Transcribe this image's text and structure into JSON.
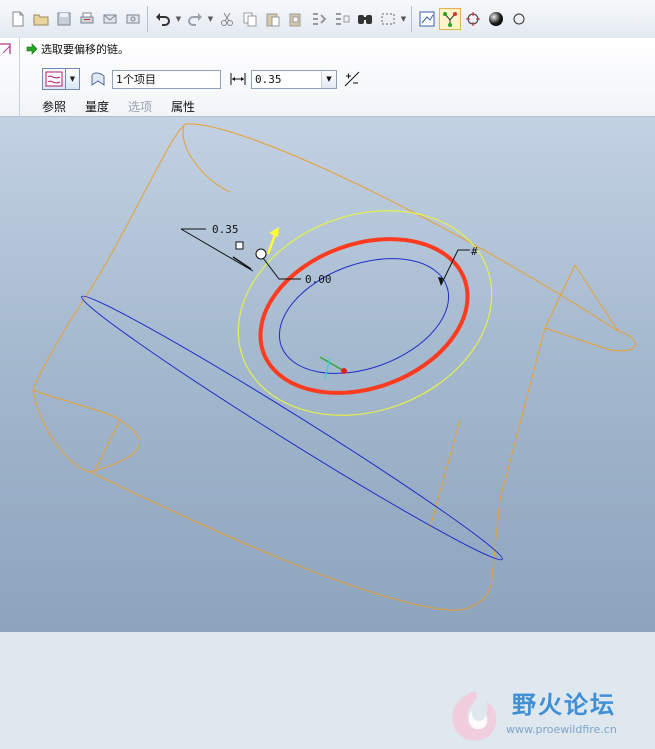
{
  "toolbar": {
    "icons": [
      "new-icon",
      "open-icon",
      "save-icon",
      "print-icon",
      "email-icon",
      "email-link-icon",
      "undo-icon",
      "redo-icon",
      "cut-icon",
      "copy-icon",
      "paste-icon",
      "paste-special-icon",
      "regenerate-icon",
      "regen-manager-icon",
      "find-icon",
      "select-box-icon",
      "sketch-view-icon",
      "datum-display-icon",
      "spin-center-icon",
      "shading-icon"
    ]
  },
  "dashboard": {
    "prompt": "选取要偏移的链。",
    "items_value": "1个项目",
    "offset_value": "0.35",
    "tabs": [
      "参照",
      "量度",
      "选项",
      "属性"
    ],
    "disabled_tab": "选项"
  },
  "canvas": {
    "dim_offset": "0.35",
    "dim_zero": "0.00",
    "dim_hash": "#",
    "colors": {
      "background_top": "#c3d2e3",
      "background_bottom": "#8da4bd",
      "solid_edge": "#e8a030",
      "highlight_chain": "#ff3b1f",
      "preview": "#e6f04a",
      "inner_curve": "#1f2ec8"
    }
  },
  "watermark": {
    "name": "野火论坛",
    "url": "www.proewildfire.cn"
  }
}
